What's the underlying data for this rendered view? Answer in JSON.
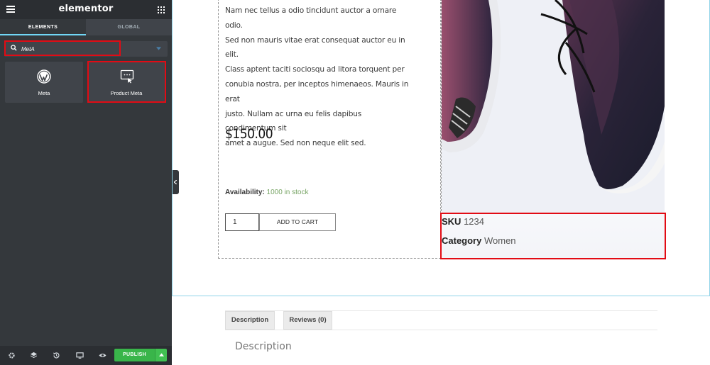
{
  "panel": {
    "logo": "elementor",
    "tabs": [
      {
        "label": "ELEMENTS"
      },
      {
        "label": "GLOBAL"
      }
    ],
    "search": {
      "value": "MetA"
    },
    "widgets": [
      {
        "label": "Meta",
        "icon": "wordpress-icon"
      },
      {
        "label": "Product Meta",
        "icon": "product-meta-icon"
      }
    ],
    "footer": {
      "icons": [
        "settings-icon",
        "layers-icon",
        "history-icon",
        "responsive-icon",
        "preview-icon"
      ],
      "publish_label": "PUBLISH"
    }
  },
  "product": {
    "description_lines": [
      "Nam nec tellus a odio tincidunt auctor a ornare odio.",
      "Sed non mauris vitae erat consequat auctor eu in elit.",
      "Class aptent taciti sociosqu ad litora torquent per",
      "conubia nostra, per inceptos himenaeos. Mauris in erat",
      "justo. Nullam ac urna eu felis dapibus condimentum sit",
      "amet a augue. Sed non neque elit sed."
    ],
    "price": "$150.00",
    "availability_label": "Availability:",
    "availability_value": "1000 in stock",
    "quantity": "1",
    "add_to_cart": "ADD TO CART",
    "meta": {
      "sku_label": "SKU",
      "sku_value": "1234",
      "category_label": "Category",
      "category_value": "Women"
    }
  },
  "product_tabs": [
    {
      "label": "Description"
    },
    {
      "label": "Reviews (0)"
    }
  ],
  "description_heading": "Description",
  "colors": {
    "panel_bg": "#34383c",
    "highlight": "#e20b14",
    "publish": "#39b54a",
    "accent_tab": "#71d7f7",
    "stock": "#77a464"
  }
}
